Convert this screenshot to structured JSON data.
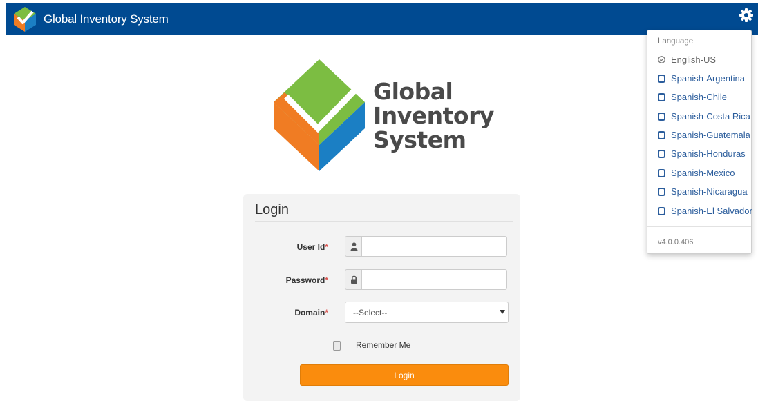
{
  "header": {
    "title": "Global Inventory System",
    "logo_icon": "gis-cube-logo-icon",
    "settings_icon": "gear-icon"
  },
  "logo": {
    "line1": "Global",
    "line2": "Inventory",
    "line3": "System"
  },
  "language_menu": {
    "header": "Language",
    "items": [
      {
        "label": "English-US",
        "selected": true
      },
      {
        "label": "Spanish-Argentina",
        "selected": false
      },
      {
        "label": "Spanish-Chile",
        "selected": false
      },
      {
        "label": "Spanish-Costa Rica",
        "selected": false
      },
      {
        "label": "Spanish-Guatemala",
        "selected": false
      },
      {
        "label": "Spanish-Honduras",
        "selected": false
      },
      {
        "label": "Spanish-Mexico",
        "selected": false
      },
      {
        "label": "Spanish-Nicaragua",
        "selected": false
      },
      {
        "label": "Spanish-El Salvador",
        "selected": false
      }
    ],
    "version": "v4.0.0.406"
  },
  "login": {
    "title": "Login",
    "user_id_label": "User Id",
    "password_label": "Password",
    "domain_label": "Domain",
    "required_mark": "*",
    "user_id_value": "",
    "password_value": "",
    "domain_selected": "--Select--",
    "remember_label": "Remember Me",
    "remember_checked": false,
    "button_label": "Login"
  },
  "colors": {
    "header_bg": "#004a91",
    "button_bg": "#fa8c0d",
    "link": "#2b5d9c",
    "logo_green": "#7cbd42",
    "logo_orange": "#f07c23",
    "logo_blue": "#1b7fc4"
  }
}
